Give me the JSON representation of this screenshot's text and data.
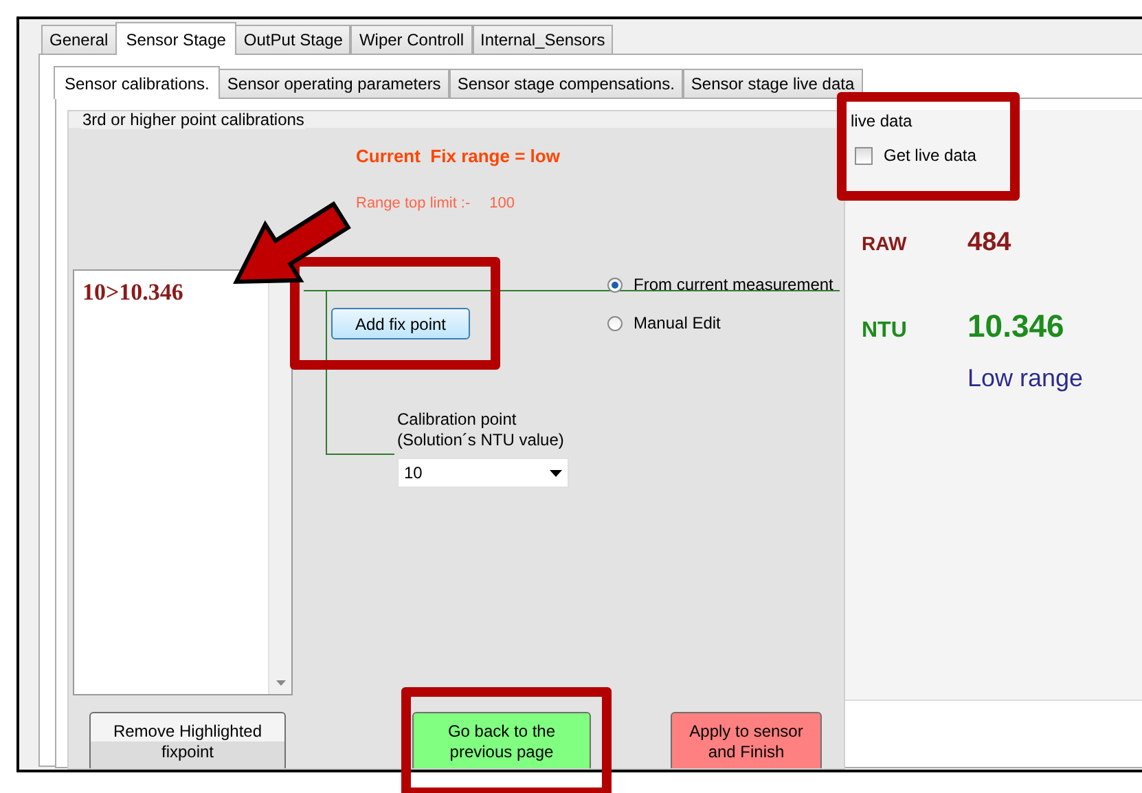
{
  "main_tabs": [
    {
      "label": "General",
      "selected": false
    },
    {
      "label": "Sensor Stage",
      "selected": true
    },
    {
      "label": "OutPut Stage",
      "selected": false
    },
    {
      "label": "Wiper Controll",
      "selected": false
    },
    {
      "label": "Internal_Sensors",
      "selected": false
    }
  ],
  "sub_tabs": [
    {
      "label": "Sensor calibrations.",
      "selected": true
    },
    {
      "label": "Sensor operating parameters",
      "selected": false
    },
    {
      "label": "Sensor stage compensations.",
      "selected": false
    },
    {
      "label": "Sensor stage live data",
      "selected": false
    }
  ],
  "calibration_group": {
    "title": "3rd or higher point calibrations",
    "fix_range": "Current  Fix range = low",
    "range_top_limit_label": "Range top limit :-",
    "range_top_limit": "100",
    "fixpoints": [
      {
        "text": "10>10.346"
      }
    ],
    "add_button": "Add fix point",
    "source_options": [
      {
        "label": "From current measurement",
        "selected": true
      },
      {
        "label": "Manual Edit",
        "selected": false
      }
    ],
    "calibration_point_label": "Calibration point\n(Solution´s NTU value)",
    "calibration_point_value": "10",
    "buttons": [
      {
        "label": "Remove Highlighted fixpoint",
        "kind": "neutral"
      },
      {
        "label": "Go back to the previous page",
        "kind": "back"
      },
      {
        "label": "Apply to sensor and Finish",
        "kind": "apply"
      }
    ]
  },
  "live_data": {
    "title": "live data",
    "get_live_data": {
      "label": "Get live data",
      "checked": false
    },
    "readings": [
      {
        "label": "RAW",
        "value": "484",
        "kind": "raw"
      },
      {
        "label": "NTU",
        "value": "10.346",
        "kind": "ntu"
      }
    ],
    "range_label": "Low range"
  }
}
